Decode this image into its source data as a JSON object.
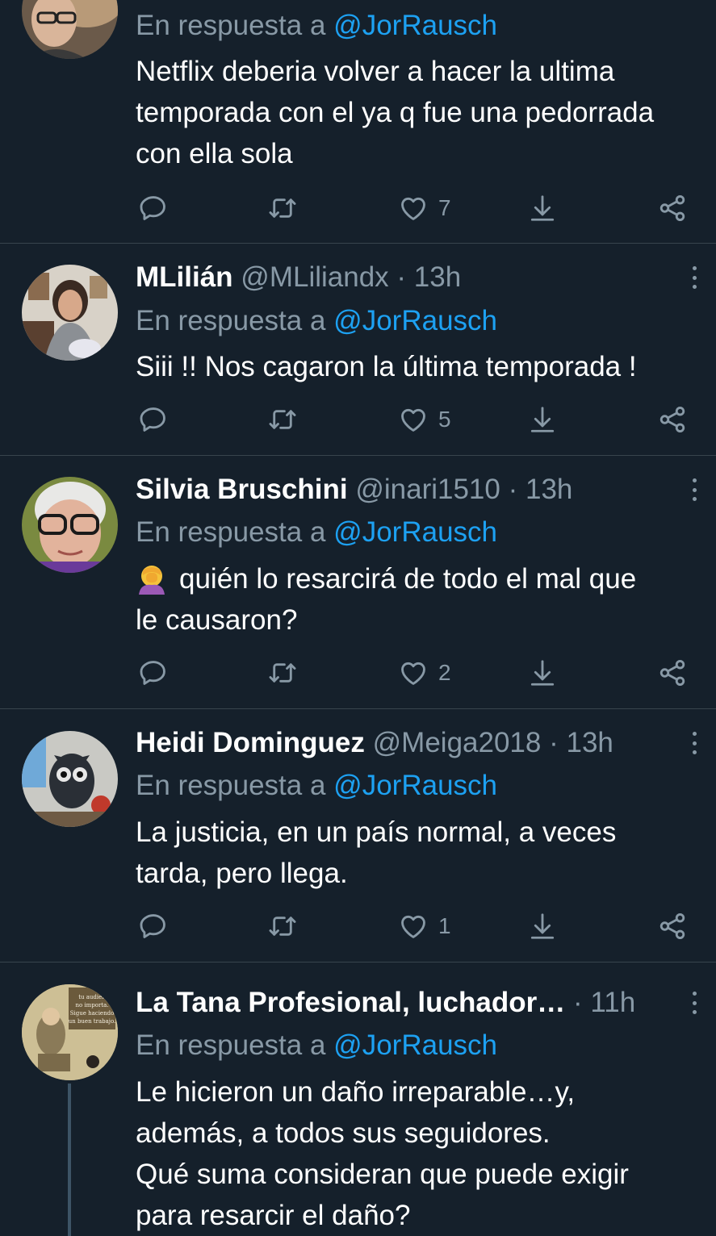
{
  "tweets": [
    {
      "name": "",
      "handle": "",
      "time": "",
      "reply_label": "En respuesta a",
      "reply_to": "@JorRausch",
      "text": "Netflix deberia volver a hacer la ultima\ntemporada con el ya q fue una pedorrada\ncon ella sola",
      "likes": "7"
    },
    {
      "name": "MLilián",
      "handle": "@MLiliandx",
      "time": "13h",
      "reply_label": "En respuesta a",
      "reply_to": "@JorRausch",
      "text": "Siii !! Nos cagaron la última temporada !",
      "likes": "5"
    },
    {
      "name": "Silvia Bruschini",
      "handle": "@inari1510",
      "time": "13h",
      "reply_label": "En respuesta a",
      "reply_to": "@JorRausch",
      "text": "quién lo resarcirá de todo el mal que\nle causaron?",
      "emoji": "🤦‍♀️",
      "likes": "2"
    },
    {
      "name": "Heidi Dominguez",
      "handle": "@Meiga2018",
      "time": "13h",
      "reply_label": "En respuesta a",
      "reply_to": "@JorRausch",
      "text": "La justicia, en un país normal, a veces\ntarda, pero llega.",
      "likes": "1"
    },
    {
      "name": "La Tana Profesional, luchador…",
      "handle": "",
      "time": "11h",
      "reply_label": "En respuesta a",
      "reply_to": "@JorRausch",
      "text": "Le hicieron un daño irreparable…y,\nademás, a todos sus seguidores.\nQué suma consideran que puede exigir\npara resarcir el daño?",
      "avatar_text": "tu audiencia no importa. Sigue haciendo un buen trabajo.",
      "likes": ""
    }
  ],
  "dot": "·",
  "colors": {
    "background": "#15202b",
    "secondary_text": "#8899a6",
    "link": "#1da1f2",
    "divider": "#38444d"
  },
  "icons": [
    "reply-icon",
    "retweet-icon",
    "like-icon",
    "download-icon",
    "share-icon",
    "more-icon"
  ]
}
